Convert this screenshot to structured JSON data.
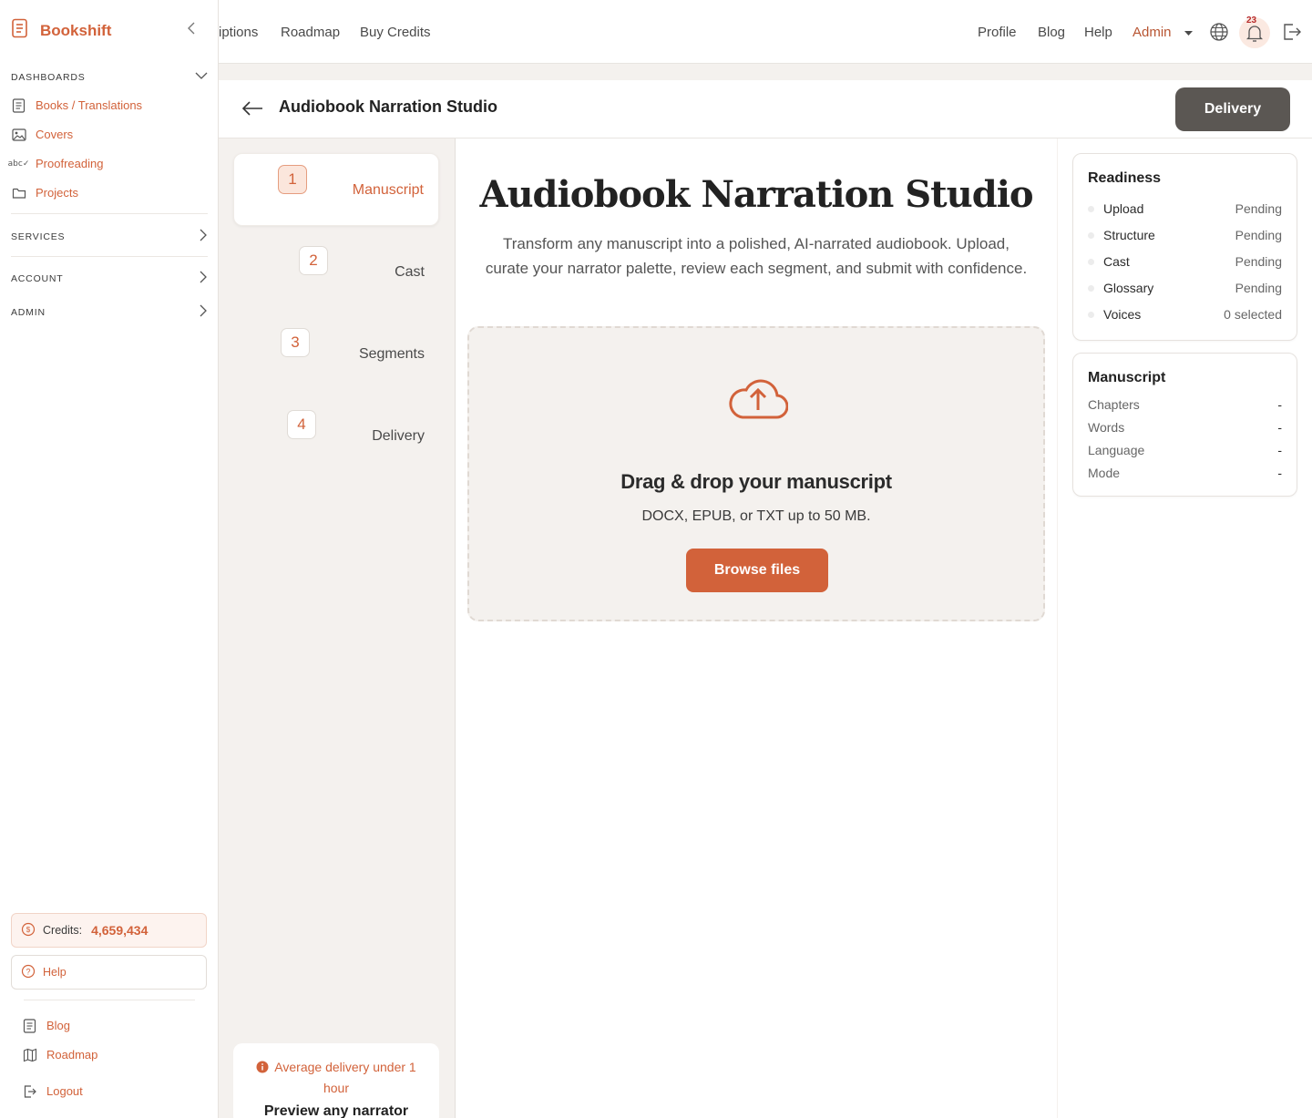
{
  "brand": {
    "name": "Bookshift"
  },
  "sidebar": {
    "dashboards_label": "DASHBOARDS",
    "dashboard_items": [
      {
        "label": "Books / Translations",
        "icon": "book-icon"
      },
      {
        "label": "Covers",
        "icon": "image-icon"
      },
      {
        "label": "Proofreading",
        "icon": "spellcheck-icon"
      },
      {
        "label": "Projects",
        "icon": "folder-icon"
      }
    ],
    "services_label": "SERVICES",
    "account_label": "ACCOUNT",
    "admin_label": "ADMIN",
    "credits_label": "Credits:",
    "credits_value": "4,659,434",
    "help_label": "Help",
    "footer_items": [
      {
        "label": "Blog",
        "icon": "book-icon"
      },
      {
        "label": "Roadmap",
        "icon": "map-icon"
      },
      {
        "label": "Logout",
        "icon": "logout-icon"
      }
    ]
  },
  "topbar": {
    "left_links": [
      "iptions",
      "Roadmap",
      "Buy Credits"
    ],
    "right_links": [
      "Profile",
      "Blog",
      "Help"
    ],
    "admin_label": "Admin",
    "notification_count": "23"
  },
  "page": {
    "title": "Audiobook Narration Studio",
    "delivery_button": "Delivery"
  },
  "steps": [
    {
      "num": "1",
      "label": "Manuscript",
      "active": true
    },
    {
      "num": "2",
      "label": "Cast",
      "active": false
    },
    {
      "num": "3",
      "label": "Segments",
      "active": false
    },
    {
      "num": "4",
      "label": "Delivery",
      "active": false
    }
  ],
  "promo": {
    "note": "Average delivery under 1 hour",
    "title": "Preview any narrator"
  },
  "main": {
    "title": "Audiobook Narration Studio",
    "subtitle": "Transform any manuscript into a polished, AI-narrated audiobook. Upload, curate your narrator palette, review each segment, and submit with confidence.",
    "dropzone_title": "Drag & drop your manuscript",
    "dropzone_sub": "DOCX, EPUB, or TXT up to 50 MB.",
    "browse_button": "Browse files"
  },
  "readiness": {
    "title": "Readiness",
    "rows": [
      {
        "label": "Upload",
        "value": "Pending"
      },
      {
        "label": "Structure",
        "value": "Pending"
      },
      {
        "label": "Cast",
        "value": "Pending"
      },
      {
        "label": "Glossary",
        "value": "Pending"
      },
      {
        "label": "Voices",
        "value": "0 selected"
      }
    ]
  },
  "manuscript": {
    "title": "Manuscript",
    "rows": [
      {
        "label": "Chapters",
        "value": "-"
      },
      {
        "label": "Words",
        "value": "-"
      },
      {
        "label": "Language",
        "value": "-"
      },
      {
        "label": "Mode",
        "value": "-"
      }
    ]
  },
  "colors": {
    "accent": "#d2623a",
    "dark_button": "#5b5753",
    "background": "#f4f1ee"
  }
}
